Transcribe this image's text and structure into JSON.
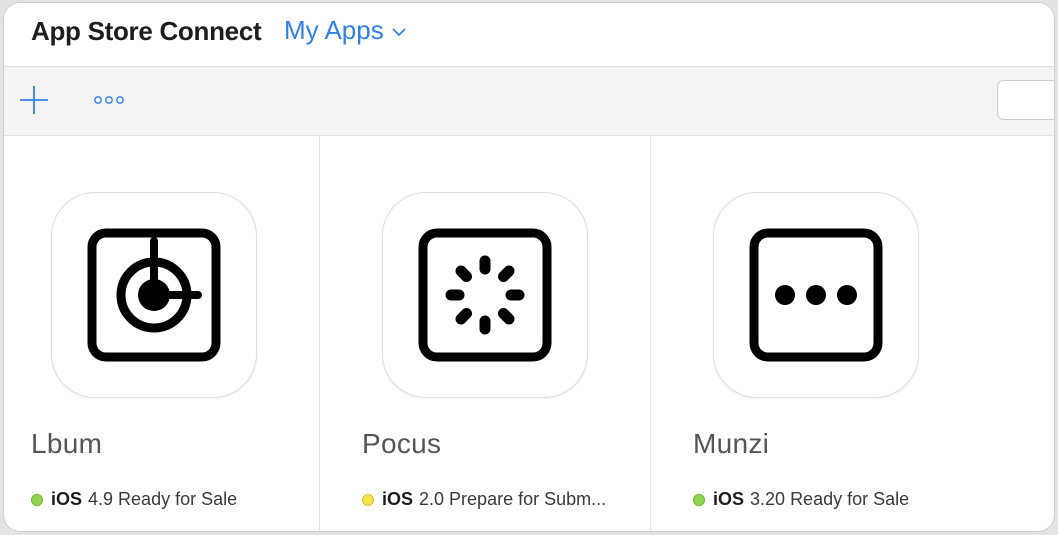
{
  "header": {
    "brand": "App Store Connect",
    "section": "My Apps",
    "section_icon": "chevron-down-icon"
  },
  "toolbar": {
    "add_icon": "plus-icon",
    "more_icon": "ellipsis-icon"
  },
  "colors": {
    "accent": "#2f80ed",
    "status_green": "#8fd34f",
    "status_yellow": "#f6e548"
  },
  "apps": [
    {
      "name": "Lbum",
      "icon": "lbum-app-icon",
      "platform": "iOS",
      "version": "4.9",
      "status": "Ready for Sale",
      "status_color": "green"
    },
    {
      "name": "Pocus",
      "icon": "pocus-app-icon",
      "platform": "iOS",
      "version": "2.0",
      "status": "Prepare for Subm...",
      "status_color": "yellow"
    },
    {
      "name": "Munzi",
      "icon": "munzi-app-icon",
      "platform": "iOS",
      "version": "3.20",
      "status": "Ready for Sale",
      "status_color": "green"
    }
  ]
}
